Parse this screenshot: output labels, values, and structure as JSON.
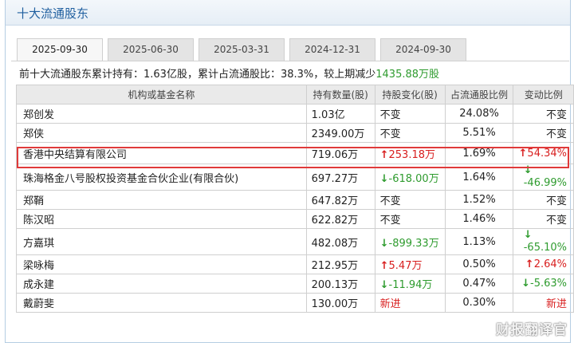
{
  "title": "十大流通股东",
  "tabs": [
    {
      "label": "2025-09-30",
      "active": true
    },
    {
      "label": "2025-06-30",
      "active": false
    },
    {
      "label": "2025-03-31",
      "active": false
    },
    {
      "label": "2024-12-31",
      "active": false
    },
    {
      "label": "2024-09-30",
      "active": false
    }
  ],
  "summary": {
    "prefix": "前十大流通股东累计持有：1.63亿股，累计占流通股比：38.3%，较上期减少",
    "change": "1435.88万股"
  },
  "headers": [
    "机构或基金名称",
    "持有数量(股)",
    "持股变化(股)",
    "占流通股比例",
    "变动比例"
  ],
  "rows": [
    {
      "name": "郑创发",
      "qty": "1.03亿",
      "chg": "不变",
      "chg_dir": "flat",
      "pct": "24.08%",
      "var": "不变",
      "var_dir": "flat"
    },
    {
      "name": "郑侠",
      "qty": "2349.00万",
      "chg": "不变",
      "chg_dir": "flat",
      "pct": "5.51%",
      "var": "不变",
      "var_dir": "flat"
    },
    {
      "name": "香港中央结算有限公司",
      "qty": "719.06万",
      "chg": "253.18万",
      "chg_dir": "up",
      "pct": "1.69%",
      "var": "54.34%",
      "var_dir": "up"
    },
    {
      "name": "珠海格金八号股权投资基金合伙企业(有限合伙)",
      "qty": "697.27万",
      "chg": "-618.00万",
      "chg_dir": "down",
      "pct": "1.64%",
      "var": "-46.99%",
      "var_dir": "down"
    },
    {
      "name": "郑鞘",
      "qty": "647.82万",
      "chg": "不变",
      "chg_dir": "flat",
      "pct": "1.52%",
      "var": "不变",
      "var_dir": "flat"
    },
    {
      "name": "陈汉昭",
      "qty": "622.82万",
      "chg": "不变",
      "chg_dir": "flat",
      "pct": "1.46%",
      "var": "不变",
      "var_dir": "flat"
    },
    {
      "name": "方嘉琪",
      "qty": "482.08万",
      "chg": "-899.33万",
      "chg_dir": "down",
      "pct": "1.13%",
      "var": "-65.10%",
      "var_dir": "down"
    },
    {
      "name": "梁咏梅",
      "qty": "212.95万",
      "chg": "5.47万",
      "chg_dir": "up",
      "pct": "0.50%",
      "var": "2.64%",
      "var_dir": "up"
    },
    {
      "name": "成永建",
      "qty": "200.13万",
      "chg": "-11.94万",
      "chg_dir": "down",
      "pct": "0.47%",
      "var": "-5.63%",
      "var_dir": "down"
    },
    {
      "name": "戴蔚斐",
      "qty": "130.00万",
      "chg": "新进",
      "chg_dir": "new",
      "pct": "0.30%",
      "var": "新进",
      "var_dir": "new"
    }
  ],
  "watermark": "财报翻译官",
  "colors": {
    "up": "#d81e1e",
    "down": "#2e9b2e",
    "title": "#1f5f9f",
    "highlight": "#e03a3a"
  }
}
